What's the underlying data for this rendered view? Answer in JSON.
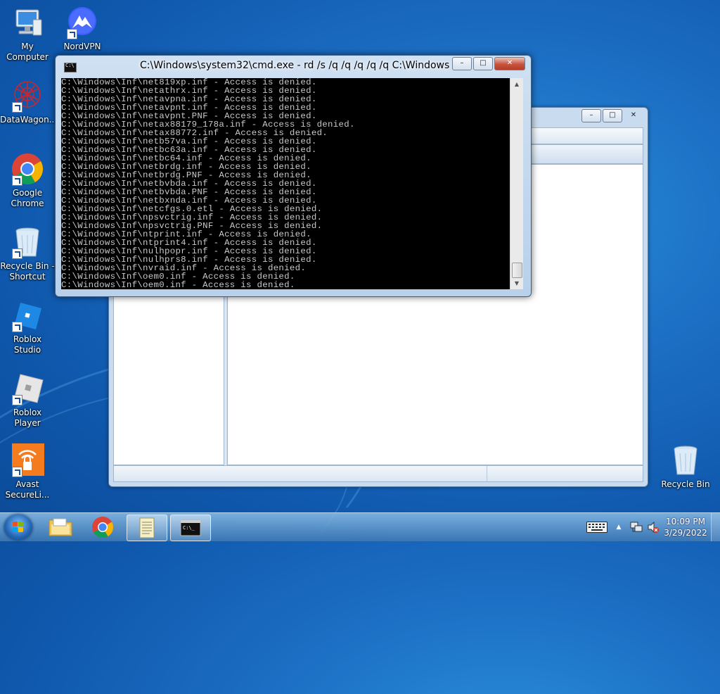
{
  "desktop": {
    "icons": [
      {
        "label": "My Computer",
        "icon": "computer-icon"
      },
      {
        "label": "NordVPN",
        "icon": "nordvpn-icon"
      },
      {
        "label": "DataWagon...",
        "icon": "datawagon-icon"
      },
      {
        "label": "Google Chrome",
        "icon": "chrome-icon"
      },
      {
        "label": "Recycle Bin - Shortcut",
        "icon": "recycle-bin-icon"
      },
      {
        "label": "Roblox Studio",
        "icon": "roblox-studio-icon"
      },
      {
        "label": "Roblox Player",
        "icon": "roblox-player-icon"
      },
      {
        "label": "Avast SecureLi...",
        "icon": "avast-icon"
      },
      {
        "label": "Recycle Bin",
        "icon": "recycle-bin-icon"
      }
    ]
  },
  "cmd_window": {
    "title": "C:\\Windows\\system32\\cmd.exe - rd  /s /q /q /q /q /q C:\\Windows",
    "buttons": {
      "minimize": "–",
      "maximize": "□",
      "close": "✕"
    },
    "lines": [
      "C:\\Windows\\Inf\\net819xp.inf - Access is denied.",
      "C:\\Windows\\Inf\\netathrx.inf - Access is denied.",
      "C:\\Windows\\Inf\\netavpna.inf - Access is denied.",
      "C:\\Windows\\Inf\\netavpnt.inf - Access is denied.",
      "C:\\Windows\\Inf\\netavpnt.PNF - Access is denied.",
      "C:\\Windows\\Inf\\netax88179_178a.inf - Access is denied.",
      "C:\\Windows\\Inf\\netax88772.inf - Access is denied.",
      "C:\\Windows\\Inf\\netb57va.inf - Access is denied.",
      "C:\\Windows\\Inf\\netbc63a.inf - Access is denied.",
      "C:\\Windows\\Inf\\netbc64.inf - Access is denied.",
      "C:\\Windows\\Inf\\netbrdg.inf - Access is denied.",
      "C:\\Windows\\Inf\\netbrdg.PNF - Access is denied.",
      "C:\\Windows\\Inf\\netbvbda.inf - Access is denied.",
      "C:\\Windows\\Inf\\netbvbda.PNF - Access is denied.",
      "C:\\Windows\\Inf\\netbxnda.inf - Access is denied.",
      "C:\\Windows\\Inf\\netcfgs.0.etl - Access is denied.",
      "C:\\Windows\\Inf\\npsvctrig.inf - Access is denied.",
      "C:\\Windows\\Inf\\npsvctrig.PNF - Access is denied.",
      "C:\\Windows\\Inf\\ntprint.inf - Access is denied.",
      "C:\\Windows\\Inf\\ntprint4.inf - Access is denied.",
      "C:\\Windows\\Inf\\nulhpopr.inf - Access is denied.",
      "C:\\Windows\\Inf\\nulhprs8.inf - Access is denied.",
      "C:\\Windows\\Inf\\nvraid.inf - Access is denied.",
      "C:\\Windows\\Inf\\oem0.inf - Access is denied.",
      "C:\\Windows\\Inf\\oem0.inf - Access is denied."
    ]
  },
  "explorer_window": {
    "buttons": {
      "minimize": "–",
      "maximize": "□",
      "close": "✕"
    }
  },
  "taskbar": {
    "apps": [
      "file-explorer-icon",
      "chrome-icon",
      "notepad-icon",
      "cmd-icon"
    ],
    "clock": {
      "time": "10:09 PM",
      "date": "3/29/2022"
    },
    "tray": [
      "keyboard-icon",
      "show-hidden-icons",
      "network-icon",
      "volume-muted-icon"
    ]
  }
}
